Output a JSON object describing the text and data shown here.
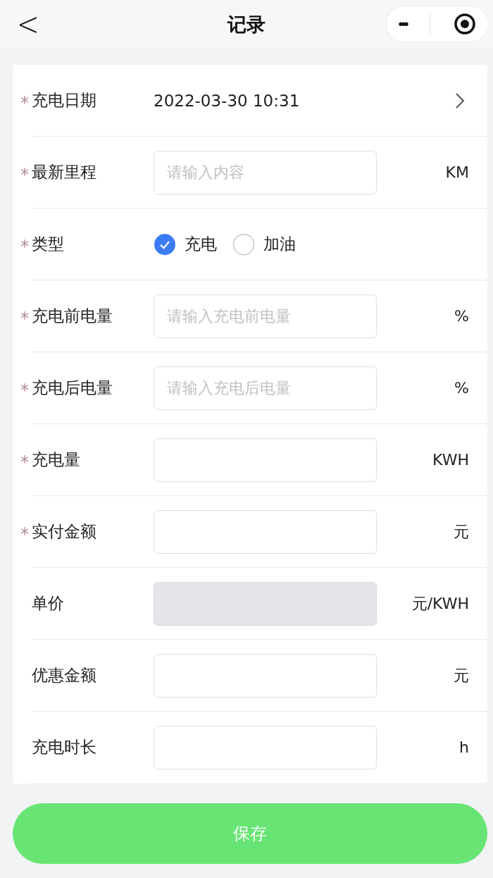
{
  "nav": {
    "title": "记录",
    "back": "<",
    "more": "•••"
  },
  "fields": [
    {
      "kind": "date",
      "mark": "*",
      "label": "充电日期",
      "value": "2022-03-30 10:31"
    },
    {
      "kind": "input",
      "mark": "*",
      "label": "最新里程",
      "placeholder": "请输入内容",
      "unit": "KM",
      "disabled": false
    },
    {
      "kind": "radio",
      "mark": "*",
      "label": "类型",
      "options": [
        {
          "label": "充电",
          "selected": true
        },
        {
          "label": "加油",
          "selected": false
        }
      ]
    },
    {
      "kind": "input",
      "mark": "*",
      "label": "充电前电量",
      "placeholder": "请输入充电前电量",
      "unit": "%",
      "disabled": false
    },
    {
      "kind": "input",
      "mark": "*",
      "label": "充电后电量",
      "placeholder": "请输入充电后电量",
      "unit": "%",
      "disabled": false
    },
    {
      "kind": "input",
      "mark": "*",
      "label": "充电量",
      "unit": "KWH",
      "disabled": false
    },
    {
      "kind": "input",
      "mark": "*",
      "label": "实付金额",
      "unit": "元",
      "disabled": false
    },
    {
      "kind": "input",
      "label": "单价",
      "unit": "元/KWH",
      "disabled": true
    },
    {
      "kind": "input",
      "label": "优惠金额",
      "unit": "元",
      "disabled": false
    },
    {
      "kind": "input",
      "label": "充电时长",
      "unit": "h",
      "disabled": false
    }
  ],
  "save_button": "保存"
}
